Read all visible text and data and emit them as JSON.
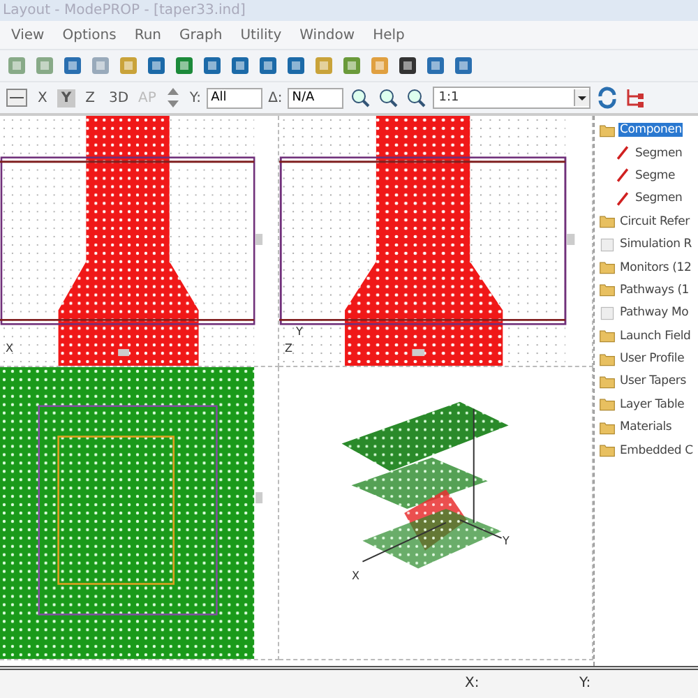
{
  "window": {
    "title": "Layout - ModePROP - [taper33.ind]"
  },
  "menu": [
    "View",
    "Options",
    "Run",
    "Graph",
    "Utility",
    "Window",
    "Help"
  ],
  "view_toolbar": {
    "scale": "1:1",
    "axes": [
      {
        "label": "X",
        "selected": false
      },
      {
        "label": "Y",
        "selected": true
      },
      {
        "label": "Z",
        "selected": false
      },
      {
        "label": "3D",
        "selected": false
      }
    ],
    "ap": "AP",
    "y_label": "Y:",
    "y_value": "All",
    "delta_label": "Δ:",
    "delta_value": "N/A"
  },
  "panes": [
    {
      "kind": "top",
      "axis_labels": [
        "X"
      ]
    },
    {
      "kind": "top",
      "axis_labels": [
        "Z",
        "Y"
      ]
    },
    {
      "kind": "square"
    },
    {
      "kind": "iso",
      "axis_labels": [
        "X",
        "Y"
      ]
    }
  ],
  "tree": [
    {
      "label": "Componen",
      "kind": "folder",
      "selected": true,
      "children": [
        {
          "label": "Segmen",
          "kind": "segment",
          "selected": false
        },
        {
          "label": "Segme",
          "kind": "segment",
          "selected": false
        },
        {
          "label": "Segmen",
          "kind": "segment",
          "selected": false
        }
      ]
    },
    {
      "label": "Circuit Refer",
      "kind": "folder",
      "selected": false
    },
    {
      "label": "Simulation R",
      "kind": "page",
      "selected": false
    },
    {
      "label": "Monitors (12",
      "kind": "folder",
      "selected": false
    },
    {
      "label": "Pathways (1",
      "kind": "folder",
      "selected": false
    },
    {
      "label": "Pathway Mo",
      "kind": "page",
      "selected": false
    },
    {
      "label": "Launch Field",
      "kind": "folder",
      "selected": false
    },
    {
      "label": "User Profile",
      "kind": "folder",
      "selected": false
    },
    {
      "label": "User Tapers",
      "kind": "folder",
      "selected": false
    },
    {
      "label": "Layer Table",
      "kind": "folder",
      "selected": false
    },
    {
      "label": "Materials",
      "kind": "folder",
      "selected": false
    },
    {
      "label": "Embedded C",
      "kind": "folder",
      "selected": false
    }
  ],
  "status_bar": {
    "x_label": "X:",
    "y_label": "Y:"
  }
}
